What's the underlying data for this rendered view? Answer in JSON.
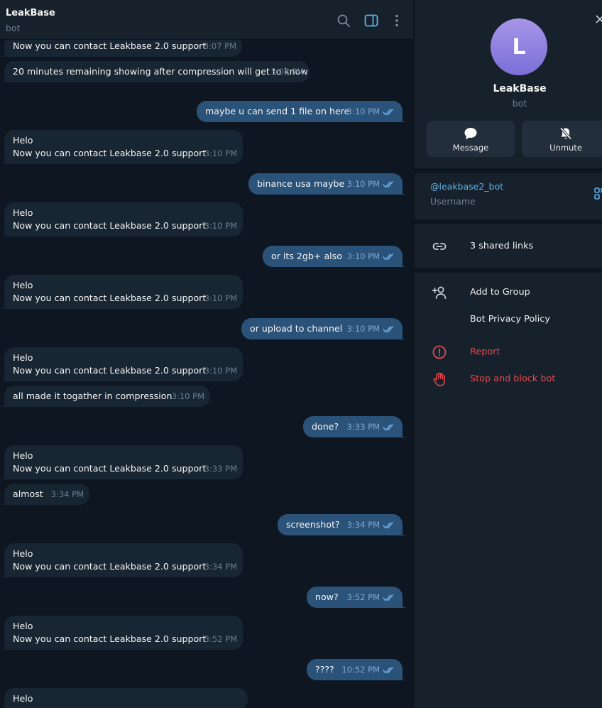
{
  "chat": {
    "title": "LeakBase",
    "subtitle": "bot",
    "messages": [
      {
        "dir": "in",
        "lines": [
          "Now you can contact Leakbase 2.0 support"
        ],
        "time": "3:07 PM"
      },
      {
        "dir": "in",
        "lines": [
          "20 minutes remaining showing after compression will get to know"
        ],
        "time": "3:08 PM"
      },
      {
        "dir": "out",
        "lines": [
          "maybe u can send 1 file on here"
        ],
        "time": "3:10 PM"
      },
      {
        "dir": "in",
        "lines": [
          "Helo",
          "Now you can contact Leakbase 2.0 support"
        ],
        "time": "3:10 PM"
      },
      {
        "dir": "out",
        "lines": [
          "binance usa maybe"
        ],
        "time": "3:10 PM"
      },
      {
        "dir": "in",
        "lines": [
          "Helo",
          "Now you can contact Leakbase 2.0 support"
        ],
        "time": "3:10 PM"
      },
      {
        "dir": "out",
        "lines": [
          "or its 2gb+ also"
        ],
        "time": "3:10 PM"
      },
      {
        "dir": "in",
        "lines": [
          "Helo",
          "Now you can contact Leakbase 2.0 support"
        ],
        "time": "3:10 PM"
      },
      {
        "dir": "out",
        "lines": [
          "or upload to channel"
        ],
        "time": "3:10 PM"
      },
      {
        "dir": "in",
        "lines": [
          "Helo",
          "Now you can contact Leakbase 2.0 support"
        ],
        "time": "3:10 PM"
      },
      {
        "dir": "in",
        "lines": [
          "all made it togather in compression"
        ],
        "time": "3:10 PM"
      },
      {
        "dir": "out",
        "lines": [
          "done?"
        ],
        "time": "3:33 PM"
      },
      {
        "dir": "in",
        "lines": [
          "Helo",
          "Now you can contact Leakbase 2.0 support"
        ],
        "time": "3:33 PM"
      },
      {
        "dir": "in",
        "lines": [
          "almost"
        ],
        "time": "3:34 PM"
      },
      {
        "dir": "out",
        "lines": [
          "screenshot?"
        ],
        "time": "3:34 PM"
      },
      {
        "dir": "in",
        "lines": [
          "Helo",
          "Now you can contact Leakbase 2.0 support"
        ],
        "time": "3:34 PM"
      },
      {
        "dir": "out",
        "lines": [
          "now?"
        ],
        "time": "3:52 PM"
      },
      {
        "dir": "in",
        "lines": [
          "Helo",
          "Now you can contact Leakbase 2.0 support"
        ],
        "time": "3:52 PM"
      },
      {
        "dir": "out",
        "lines": [
          "????"
        ],
        "time": "10:52 PM"
      },
      {
        "dir": "in",
        "lines": [
          "Helo"
        ],
        "time": ""
      }
    ]
  },
  "header_icons": [
    "search-icon",
    "sidebar-toggle-icon",
    "more-vertical-icon"
  ],
  "profile": {
    "avatar_letter": "L",
    "name": "LeakBase",
    "status": "bot",
    "message_label": "Message",
    "unmute_label": "Unmute",
    "username": "@leakbase2_bot",
    "username_caption": "Username",
    "shared_links": "3 shared links",
    "add_to_group": "Add to Group",
    "privacy_policy": "Bot Privacy Policy",
    "report": "Report",
    "stop_block": "Stop and block bot"
  },
  "colors": {
    "chat_bg": "#0e1621",
    "panel_bg": "#17212b",
    "incoming_bubble": "#182533",
    "outgoing_bubble": "#2b5278",
    "accent": "#5fb1e6",
    "danger": "#e5484d"
  }
}
